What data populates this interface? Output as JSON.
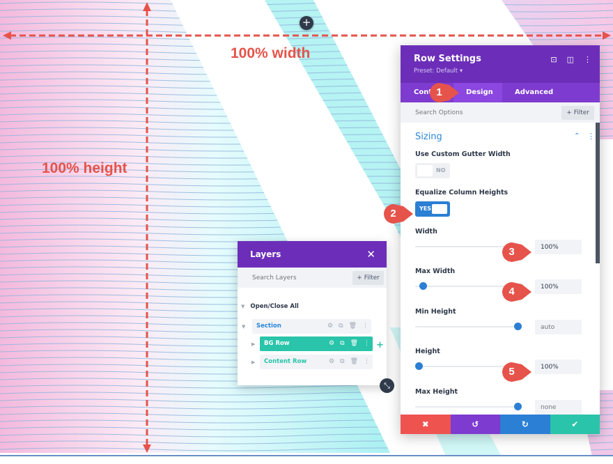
{
  "canvas": {
    "add_section_label": "+",
    "colors": {
      "pink": "#f5c6e4",
      "cyan": "#b6f3f3",
      "stripe": "#8fb4dc",
      "annotation": "#e5534b"
    }
  },
  "annotations": {
    "width_label": "100% width",
    "height_label": "100% height",
    "markers": [
      "1",
      "2",
      "3",
      "4",
      "5"
    ]
  },
  "settings": {
    "title": "Row Settings",
    "preset": "Preset: Default ▾",
    "header_icons": [
      "focus-icon",
      "split-view-icon",
      "more-icon"
    ],
    "tabs": [
      {
        "label": "Content",
        "visible_label": "Cont",
        "active": false
      },
      {
        "label": "Design",
        "active": true
      },
      {
        "label": "Advanced",
        "active": false
      }
    ],
    "search_placeholder": "Search Options",
    "filter_label": "+ Filter",
    "section": {
      "title": "Sizing",
      "expanded": true,
      "options": [
        {
          "label": "Use Custom Gutter Width",
          "type": "toggle",
          "value": "NO"
        },
        {
          "label": "Equalize Column Heights",
          "type": "toggle",
          "value": "YES"
        },
        {
          "label": "Width",
          "type": "range",
          "value": "100%",
          "slider_fraction": 1.0,
          "handle_visible": false
        },
        {
          "label": "Max Width",
          "type": "range",
          "value": "100%",
          "slider_fraction": 0.07
        },
        {
          "label": "Min Height",
          "type": "range",
          "value": "",
          "placeholder": "auto",
          "slider_fraction": 0.98
        },
        {
          "label": "Height",
          "type": "range",
          "value": "100%",
          "slider_fraction": 0.03
        },
        {
          "label": "Max Height",
          "type": "range",
          "value": "",
          "placeholder": "none",
          "slider_fraction": 0.98
        }
      ]
    },
    "footer": {
      "cancel": "✖",
      "undo": "↺",
      "redo": "↻",
      "save": "✔",
      "colors": {
        "cancel": "#ef5350",
        "undo": "#7e3bd0",
        "redo": "#2b7fd4",
        "save": "#29c4a9"
      }
    }
  },
  "layers": {
    "title": "Layers",
    "close": "✕",
    "search_placeholder": "Search Layers",
    "filter_label": "+ Filter",
    "open_close_all": "Open/Close All",
    "items": [
      {
        "label": "Section",
        "level": 0,
        "type": "section",
        "active": false
      },
      {
        "label": "BG Row",
        "level": 1,
        "type": "row",
        "active": true
      },
      {
        "label": "Content Row",
        "level": 1,
        "type": "row",
        "active": false
      }
    ],
    "item_actions": [
      "settings-icon",
      "duplicate-icon",
      "delete-icon",
      "more-icon"
    ],
    "add_label": "+",
    "resize_icon": "⤡"
  }
}
